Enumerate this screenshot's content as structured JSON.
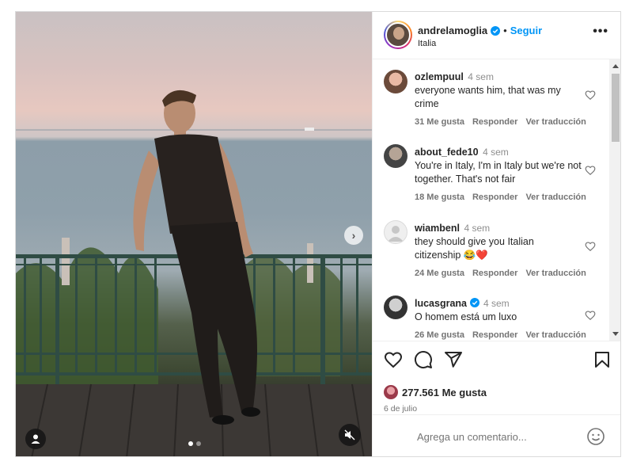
{
  "post": {
    "username": "andrelamoglia",
    "verified": true,
    "follow_label": "Seguir",
    "separator": "•",
    "location": "Italia",
    "more_label": "•••"
  },
  "media": {
    "carousel_count": 2,
    "active_index": 0,
    "icons": [
      "chevron-right-icon",
      "user-tag-icon",
      "muted-speaker-icon"
    ]
  },
  "comments": [
    {
      "username": "ozlempuul",
      "verified": false,
      "time": "4 sem",
      "text": "everyone wants him, that was my crime",
      "likes": "31 Me gusta",
      "reply": "Responder",
      "translate": "Ver traducción"
    },
    {
      "username": "about_fede10",
      "verified": false,
      "time": "4 sem",
      "text": "You're in Italy, I'm in Italy but we're not together. That's not fair",
      "likes": "18 Me gusta",
      "reply": "Responder",
      "translate": "Ver traducción"
    },
    {
      "username": "wiambenl",
      "verified": false,
      "time": "4 sem",
      "text": "they should give you Italian citizenship 😂❤️",
      "likes": "24 Me gusta",
      "reply": "Responder",
      "translate": "Ver traducción"
    },
    {
      "username": "lucasgrana",
      "verified": true,
      "time": "4 sem",
      "text": "O homem está um luxo",
      "likes": "26 Me gusta",
      "reply": "Responder",
      "translate": "Ver traducción"
    }
  ],
  "actions": {
    "icons": [
      "heart-icon",
      "comment-icon",
      "share-icon",
      "bookmark-icon"
    ],
    "likes_count": "277.561 Me gusta",
    "date": "6 de julio"
  },
  "composer": {
    "placeholder": "Agrega un comentario...",
    "icon": "emoji-icon"
  },
  "colors": {
    "accent_blue": "#0095f6",
    "verified_blue": "#0095f6",
    "text_primary": "#262626",
    "text_secondary": "#737373",
    "border": "#dbdbdb"
  }
}
